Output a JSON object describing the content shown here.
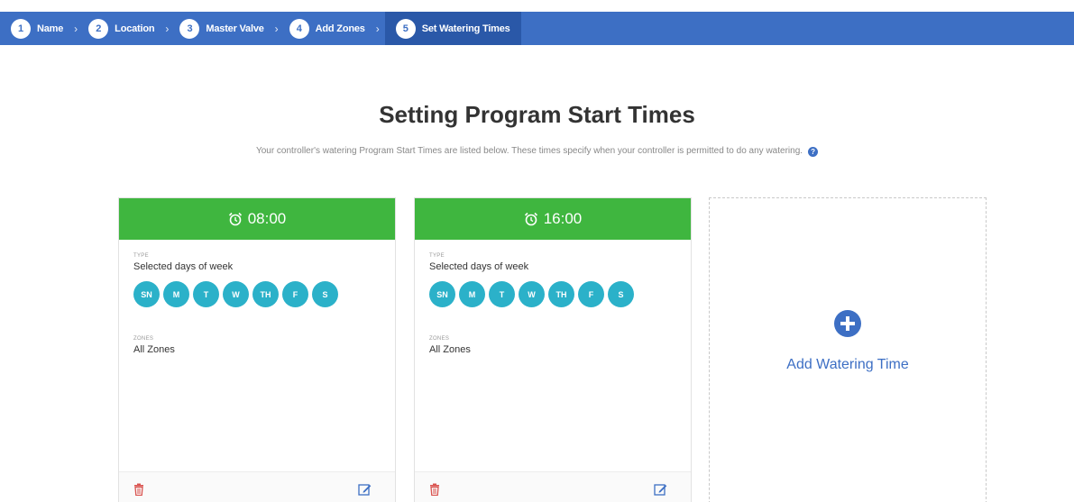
{
  "wizard": {
    "steps": [
      {
        "num": "1",
        "label": "Name"
      },
      {
        "num": "2",
        "label": "Location"
      },
      {
        "num": "3",
        "label": "Master Valve"
      },
      {
        "num": "4",
        "label": "Add Zones"
      },
      {
        "num": "5",
        "label": "Set Watering Times"
      }
    ],
    "separator": "›",
    "accent": "#3d6fc4"
  },
  "page": {
    "title": "Setting Program Start Times",
    "subtitle": "Your controller's watering Program Start Times are listed below. These times specify when your controller is permitted to do any watering."
  },
  "cards": [
    {
      "time": "08:00",
      "type_label": "TYPE",
      "type_value": "Selected days of week",
      "days": [
        "SN",
        "M",
        "T",
        "W",
        "TH",
        "F",
        "S"
      ],
      "zones_label": "ZONES",
      "zones_value": "All Zones"
    },
    {
      "time": "16:00",
      "type_label": "TYPE",
      "type_value": "Selected days of week",
      "days": [
        "SN",
        "M",
        "T",
        "W",
        "TH",
        "F",
        "S"
      ],
      "zones_label": "ZONES",
      "zones_value": "All Zones"
    }
  ],
  "add_card": {
    "label": "Add Watering Time"
  },
  "colors": {
    "header_green": "#3fb63f",
    "day_teal": "#2bb1c9",
    "delete_red": "#d9534f"
  },
  "icons": [
    "alarm-clock-icon",
    "trash-icon",
    "edit-icon",
    "plus-circle-icon",
    "info-icon"
  ]
}
